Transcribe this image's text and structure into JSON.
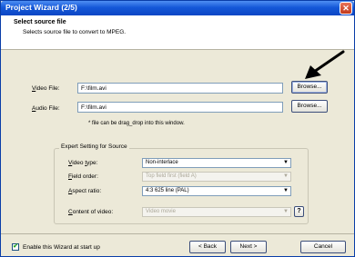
{
  "window": {
    "title": "Project Wizard (2/5)"
  },
  "header": {
    "title": "Select source file",
    "subtitle": "Selects source file to convert to MPEG."
  },
  "video_file": {
    "label": "Video File:",
    "value": "F:\\film.avi",
    "browse_label": "Browse..."
  },
  "audio_file": {
    "label": "Audio File:",
    "value": "F:\\film.avi",
    "browse_label": "Browse..."
  },
  "hint": "* file can be drag_drop into this window.",
  "expert": {
    "legend": "Expert Setting for Source",
    "video_type": {
      "label": "Video type:",
      "value": "Non-interlace"
    },
    "field_order": {
      "label": "Field order:",
      "value": "Top field first (field A)"
    },
    "aspect_ratio": {
      "label": "Aspect ratio:",
      "value": "4:3 625 line (PAL)"
    },
    "content": {
      "label": "Content of video:",
      "value": "Video movie",
      "help_label": "?"
    }
  },
  "footer": {
    "checkbox_label": "Enable this Wizard at start up",
    "checkbox_checked": true,
    "back_label": "< Back",
    "next_label": "Next >",
    "cancel_label": "Cancel"
  },
  "icons": {
    "close": "close-icon",
    "annotation": "arrow-pointer-icon"
  },
  "colors": {
    "titlebar": "#1558d8",
    "dialog_bg": "#ece9d8",
    "close": "#c13a1d"
  }
}
